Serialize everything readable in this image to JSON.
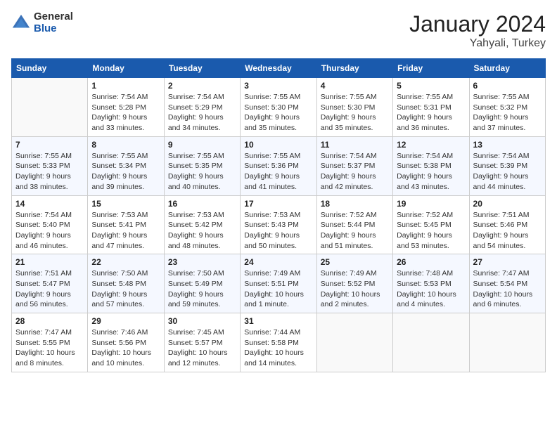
{
  "header": {
    "logo_general": "General",
    "logo_blue": "Blue",
    "month_title": "January 2024",
    "location": "Yahyali, Turkey"
  },
  "days_of_week": [
    "Sunday",
    "Monday",
    "Tuesday",
    "Wednesday",
    "Thursday",
    "Friday",
    "Saturday"
  ],
  "weeks": [
    [
      {
        "day": "",
        "sunrise": "",
        "sunset": "",
        "daylight": ""
      },
      {
        "day": "1",
        "sunrise": "Sunrise: 7:54 AM",
        "sunset": "Sunset: 5:28 PM",
        "daylight": "Daylight: 9 hours and 33 minutes."
      },
      {
        "day": "2",
        "sunrise": "Sunrise: 7:54 AM",
        "sunset": "Sunset: 5:29 PM",
        "daylight": "Daylight: 9 hours and 34 minutes."
      },
      {
        "day": "3",
        "sunrise": "Sunrise: 7:55 AM",
        "sunset": "Sunset: 5:30 PM",
        "daylight": "Daylight: 9 hours and 35 minutes."
      },
      {
        "day": "4",
        "sunrise": "Sunrise: 7:55 AM",
        "sunset": "Sunset: 5:30 PM",
        "daylight": "Daylight: 9 hours and 35 minutes."
      },
      {
        "day": "5",
        "sunrise": "Sunrise: 7:55 AM",
        "sunset": "Sunset: 5:31 PM",
        "daylight": "Daylight: 9 hours and 36 minutes."
      },
      {
        "day": "6",
        "sunrise": "Sunrise: 7:55 AM",
        "sunset": "Sunset: 5:32 PM",
        "daylight": "Daylight: 9 hours and 37 minutes."
      }
    ],
    [
      {
        "day": "7",
        "sunrise": "Sunrise: 7:55 AM",
        "sunset": "Sunset: 5:33 PM",
        "daylight": "Daylight: 9 hours and 38 minutes."
      },
      {
        "day": "8",
        "sunrise": "Sunrise: 7:55 AM",
        "sunset": "Sunset: 5:34 PM",
        "daylight": "Daylight: 9 hours and 39 minutes."
      },
      {
        "day": "9",
        "sunrise": "Sunrise: 7:55 AM",
        "sunset": "Sunset: 5:35 PM",
        "daylight": "Daylight: 9 hours and 40 minutes."
      },
      {
        "day": "10",
        "sunrise": "Sunrise: 7:55 AM",
        "sunset": "Sunset: 5:36 PM",
        "daylight": "Daylight: 9 hours and 41 minutes."
      },
      {
        "day": "11",
        "sunrise": "Sunrise: 7:54 AM",
        "sunset": "Sunset: 5:37 PM",
        "daylight": "Daylight: 9 hours and 42 minutes."
      },
      {
        "day": "12",
        "sunrise": "Sunrise: 7:54 AM",
        "sunset": "Sunset: 5:38 PM",
        "daylight": "Daylight: 9 hours and 43 minutes."
      },
      {
        "day": "13",
        "sunrise": "Sunrise: 7:54 AM",
        "sunset": "Sunset: 5:39 PM",
        "daylight": "Daylight: 9 hours and 44 minutes."
      }
    ],
    [
      {
        "day": "14",
        "sunrise": "Sunrise: 7:54 AM",
        "sunset": "Sunset: 5:40 PM",
        "daylight": "Daylight: 9 hours and 46 minutes."
      },
      {
        "day": "15",
        "sunrise": "Sunrise: 7:53 AM",
        "sunset": "Sunset: 5:41 PM",
        "daylight": "Daylight: 9 hours and 47 minutes."
      },
      {
        "day": "16",
        "sunrise": "Sunrise: 7:53 AM",
        "sunset": "Sunset: 5:42 PM",
        "daylight": "Daylight: 9 hours and 48 minutes."
      },
      {
        "day": "17",
        "sunrise": "Sunrise: 7:53 AM",
        "sunset": "Sunset: 5:43 PM",
        "daylight": "Daylight: 9 hours and 50 minutes."
      },
      {
        "day": "18",
        "sunrise": "Sunrise: 7:52 AM",
        "sunset": "Sunset: 5:44 PM",
        "daylight": "Daylight: 9 hours and 51 minutes."
      },
      {
        "day": "19",
        "sunrise": "Sunrise: 7:52 AM",
        "sunset": "Sunset: 5:45 PM",
        "daylight": "Daylight: 9 hours and 53 minutes."
      },
      {
        "day": "20",
        "sunrise": "Sunrise: 7:51 AM",
        "sunset": "Sunset: 5:46 PM",
        "daylight": "Daylight: 9 hours and 54 minutes."
      }
    ],
    [
      {
        "day": "21",
        "sunrise": "Sunrise: 7:51 AM",
        "sunset": "Sunset: 5:47 PM",
        "daylight": "Daylight: 9 hours and 56 minutes."
      },
      {
        "day": "22",
        "sunrise": "Sunrise: 7:50 AM",
        "sunset": "Sunset: 5:48 PM",
        "daylight": "Daylight: 9 hours and 57 minutes."
      },
      {
        "day": "23",
        "sunrise": "Sunrise: 7:50 AM",
        "sunset": "Sunset: 5:49 PM",
        "daylight": "Daylight: 9 hours and 59 minutes."
      },
      {
        "day": "24",
        "sunrise": "Sunrise: 7:49 AM",
        "sunset": "Sunset: 5:51 PM",
        "daylight": "Daylight: 10 hours and 1 minute."
      },
      {
        "day": "25",
        "sunrise": "Sunrise: 7:49 AM",
        "sunset": "Sunset: 5:52 PM",
        "daylight": "Daylight: 10 hours and 2 minutes."
      },
      {
        "day": "26",
        "sunrise": "Sunrise: 7:48 AM",
        "sunset": "Sunset: 5:53 PM",
        "daylight": "Daylight: 10 hours and 4 minutes."
      },
      {
        "day": "27",
        "sunrise": "Sunrise: 7:47 AM",
        "sunset": "Sunset: 5:54 PM",
        "daylight": "Daylight: 10 hours and 6 minutes."
      }
    ],
    [
      {
        "day": "28",
        "sunrise": "Sunrise: 7:47 AM",
        "sunset": "Sunset: 5:55 PM",
        "daylight": "Daylight: 10 hours and 8 minutes."
      },
      {
        "day": "29",
        "sunrise": "Sunrise: 7:46 AM",
        "sunset": "Sunset: 5:56 PM",
        "daylight": "Daylight: 10 hours and 10 minutes."
      },
      {
        "day": "30",
        "sunrise": "Sunrise: 7:45 AM",
        "sunset": "Sunset: 5:57 PM",
        "daylight": "Daylight: 10 hours and 12 minutes."
      },
      {
        "day": "31",
        "sunrise": "Sunrise: 7:44 AM",
        "sunset": "Sunset: 5:58 PM",
        "daylight": "Daylight: 10 hours and 14 minutes."
      },
      {
        "day": "",
        "sunrise": "",
        "sunset": "",
        "daylight": ""
      },
      {
        "day": "",
        "sunrise": "",
        "sunset": "",
        "daylight": ""
      },
      {
        "day": "",
        "sunrise": "",
        "sunset": "",
        "daylight": ""
      }
    ]
  ]
}
